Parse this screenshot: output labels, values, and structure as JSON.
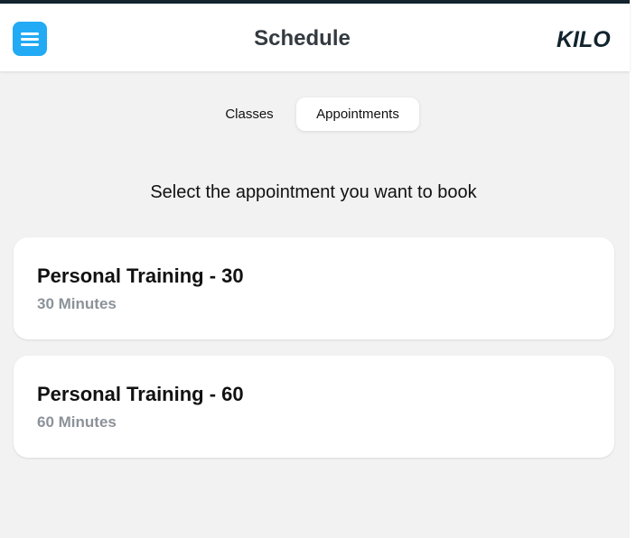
{
  "header": {
    "title": "Schedule",
    "logo_text": "KILO",
    "menu_icon": "hamburger-menu-icon"
  },
  "tabs": [
    {
      "label": "Classes",
      "active": false
    },
    {
      "label": "Appointments",
      "active": true
    }
  ],
  "main": {
    "subtitle": "Select the appointment you want to book",
    "appointments": [
      {
        "title": "Personal Training - 30",
        "duration": "30 Minutes"
      },
      {
        "title": "Personal Training - 60",
        "duration": "60 Minutes"
      }
    ]
  },
  "colors": {
    "accent": "#22aaf5",
    "brand_dark": "#13242e",
    "background": "#f2f2f2",
    "card": "#ffffff",
    "muted_text": "#8b9299"
  }
}
